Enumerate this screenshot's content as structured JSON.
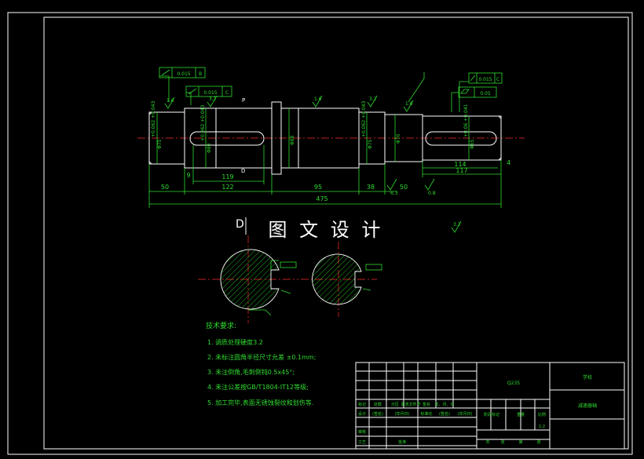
{
  "watermark": "图 文 设 计",
  "dims": {
    "total": "475",
    "d50_left": "50",
    "d9": "9",
    "d119": "119",
    "d122": "122",
    "d95": "95",
    "d38": "38",
    "d50_right": "50",
    "d114": "114",
    "d117": "117",
    "d4": "4"
  },
  "diameters": {
    "d75_left_tol": "+0.062\n+0.043",
    "d75_left": "Φ75",
    "d80_tol": "+0.062\n+0.043",
    "d80": "Φ80",
    "d88": "Φ88",
    "d75_right_tol": "+0.062\n+0.043",
    "d75_right": "Φ75",
    "d70": "Φ70",
    "d65_tol": "+0.06\n+0.041",
    "d65": "Φ65"
  },
  "tolerances": {
    "runout_b": {
      "value": "0.015",
      "datum": "B"
    },
    "runout_c_left": {
      "value": "0.015",
      "datum": "C"
    },
    "runout_c_right": {
      "value": "0.015",
      "datum": "C"
    },
    "cylindricity": {
      "value": "0.05"
    }
  },
  "roughness": [
    "1.6",
    "3.2",
    "1.6",
    "3.2",
    "1.6",
    "0.8",
    "6.3",
    "3.2"
  ],
  "section_label": "D",
  "notes": {
    "title": "技术要求:",
    "items": [
      "1. 调质处理硬度3.2",
      "2. 未标注圆角半径尺寸允差 ±0.1mm;",
      "3. 未注倒角,毛刺倒钝0.5x45°;",
      "4. 未注公差按GB/T1804-IT12等级;",
      "5. 加工完毕,表面无锈蚀裂纹和划伤等."
    ]
  },
  "title_block": {
    "material": "Q235",
    "school": "学校",
    "part_name": "减速器轴",
    "scale": "1:2",
    "header_row": [
      "标记",
      "处数",
      "分区",
      "更改文件号",
      "签名",
      "年、月、日"
    ],
    "design_row": [
      "设计",
      "(签名)",
      "(年月日)",
      "标准化",
      "(签名)",
      "(年月日)"
    ],
    "stage_labels": [
      "阶段标记",
      "重量",
      "比例"
    ],
    "review": "审核",
    "process": "工艺",
    "approve": "批准",
    "sheets": [
      "共",
      "张",
      "第",
      "张"
    ]
  }
}
